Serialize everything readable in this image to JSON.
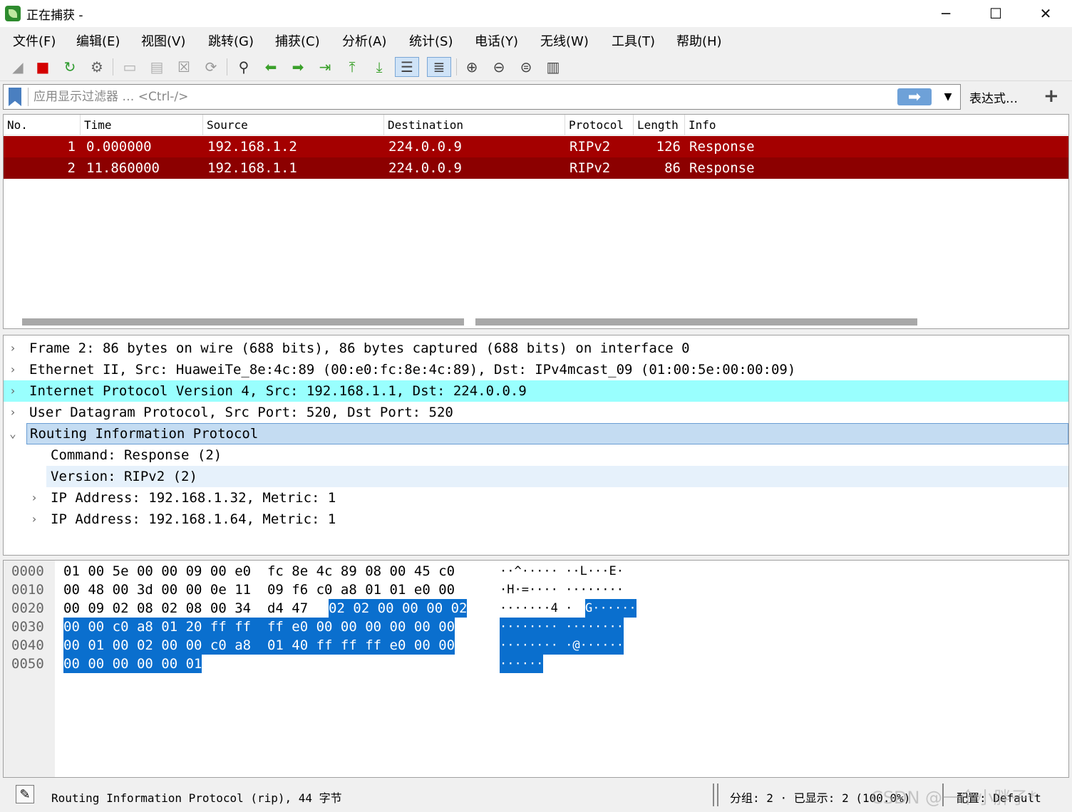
{
  "window": {
    "title": "正在捕获 -",
    "min_glyph": "─",
    "max_glyph": "☐",
    "close_glyph": "✕"
  },
  "menu": [
    "文件(F)",
    "编辑(E)",
    "视图(V)",
    "跳转(G)",
    "捕获(C)",
    "分析(A)",
    "统计(S)",
    "电话(Y)",
    "无线(W)",
    "工具(T)",
    "帮助(H)"
  ],
  "toolbar": [
    {
      "name": "start-capture-icon",
      "glyph": "◢",
      "color": "#9a9a9a"
    },
    {
      "name": "stop-capture-icon",
      "glyph": "■",
      "color": "#d40000"
    },
    {
      "name": "restart-capture-icon",
      "glyph": "↻",
      "color": "#2e9b2e"
    },
    {
      "name": "capture-options-icon",
      "glyph": "⚙",
      "color": "#666666"
    },
    {
      "name": "open-file-icon",
      "glyph": "▭",
      "color": "#b0b0b0"
    },
    {
      "name": "save-file-icon",
      "glyph": "▤",
      "color": "#b0b0b0"
    },
    {
      "name": "close-file-icon",
      "glyph": "☒",
      "color": "#9a9a9a"
    },
    {
      "name": "reload-file-icon",
      "glyph": "⟳",
      "color": "#9a9a9a"
    },
    {
      "name": "find-packet-icon",
      "glyph": "⚲",
      "color": "#333333"
    },
    {
      "name": "go-back-icon",
      "glyph": "⬅",
      "color": "#3aa02a"
    },
    {
      "name": "go-forward-icon",
      "glyph": "➡",
      "color": "#3aa02a"
    },
    {
      "name": "go-to-packet-icon",
      "glyph": "⇥",
      "color": "#3aa02a"
    },
    {
      "name": "first-packet-icon",
      "glyph": "⤒",
      "color": "#3aa02a"
    },
    {
      "name": "last-packet-icon",
      "glyph": "⤓",
      "color": "#3aa02a"
    },
    {
      "name": "auto-scroll-icon",
      "glyph": "☰",
      "color": "#444444"
    },
    {
      "name": "colorize-icon",
      "glyph": "≣",
      "color": "#444444"
    },
    {
      "name": "zoom-in-icon",
      "glyph": "⊕",
      "color": "#444444"
    },
    {
      "name": "zoom-out-icon",
      "glyph": "⊖",
      "color": "#444444"
    },
    {
      "name": "zoom-normal-icon",
      "glyph": "⊜",
      "color": "#444444"
    },
    {
      "name": "resize-columns-icon",
      "glyph": "▥",
      "color": "#444444"
    }
  ],
  "filter": {
    "placeholder": "应用显示过滤器 … <Ctrl-/>",
    "apply_glyph": "➡",
    "dropdown_glyph": "▼",
    "expression_label": "表达式…",
    "add_label": "+"
  },
  "packet_list": {
    "columns": [
      "No.",
      "Time",
      "Source",
      "Destination",
      "Protocol",
      "Length",
      "Info"
    ],
    "rows": [
      {
        "no": "1",
        "time": "0.000000",
        "source": "192.168.1.2",
        "destination": "224.0.0.9",
        "protocol": "RIPv2",
        "length": "126",
        "info": "Response",
        "bg": "#a40000"
      },
      {
        "no": "2",
        "time": "11.860000",
        "source": "192.168.1.1",
        "destination": "224.0.0.9",
        "protocol": "RIPv2",
        "length": "86",
        "info": "Response",
        "bg": "#8c0000"
      }
    ]
  },
  "detail_tree": [
    {
      "text": "Frame 2: 86 bytes on wire (688 bits), 86 bytes captured (688 bits) on interface 0",
      "chevron": "›"
    },
    {
      "text": "Ethernet II, Src: HuaweiTe_8e:4c:89 (00:e0:fc:8e:4c:89), Dst: IPv4mcast_09 (01:00:5e:00:00:09)",
      "chevron": "›"
    },
    {
      "text": "Internet Protocol Version 4, Src: 192.168.1.1, Dst: 224.0.0.9",
      "chevron": "›"
    },
    {
      "text": "User Datagram Protocol, Src Port: 520, Dst Port: 520",
      "chevron": "›"
    },
    {
      "text": "Routing Information Protocol",
      "chevron": "⌄"
    },
    {
      "text": "Command: Response (2)",
      "chevron": ""
    },
    {
      "text": "Version: RIPv2 (2)",
      "chevron": ""
    },
    {
      "text": "IP Address: 192.168.1.32, Metric: 1",
      "chevron": "›"
    },
    {
      "text": "IP Address: 192.168.1.64, Metric: 1",
      "chevron": "›"
    }
  ],
  "bytes": {
    "offsets": [
      "0000",
      "0010",
      "0020",
      "0030",
      "0040",
      "0050"
    ],
    "hex_plain": [
      "01 00 5e 00 00 09 00 e0  fc 8e 4c 89 08 00 45 c0",
      "00 48 00 3d 00 00 0e 11  09 f6 c0 a8 01 01 e0 00",
      "00 09 02 08 02 08 00 34  d4 47 ",
      "",
      "",
      ""
    ],
    "hex_hl": [
      "",
      "",
      "02 02 00 00 00 02",
      "00 00 c0 a8 01 20 ff ff  ff e0 00 00 00 00 00 00",
      "00 01 00 02 00 00 c0 a8  01 40 ff ff ff e0 00 00",
      "00 00 00 00 00 01"
    ],
    "ascii_plain": [
      "··^····· ··L···E·",
      "·H·=···· ········",
      "·······4 ·",
      "",
      "",
      ""
    ],
    "ascii_hl": [
      "",
      "",
      "G······",
      "········ ········",
      "········ ·@······",
      "······"
    ]
  },
  "status": {
    "text": "Routing Information Protocol (rip), 44 字节",
    "packets": "分组: 2 · 已显示: 2 (100.0%)",
    "profile": "配置: Default",
    "watermark": "CSDN @一个小胖子*"
  },
  "colors": {
    "ip_row_bg": "#99fffe",
    "selected_row_bg": "#c4dcf2",
    "version_row_bg": "#e6f1fb",
    "hex_highlight": "#0a6fce"
  }
}
